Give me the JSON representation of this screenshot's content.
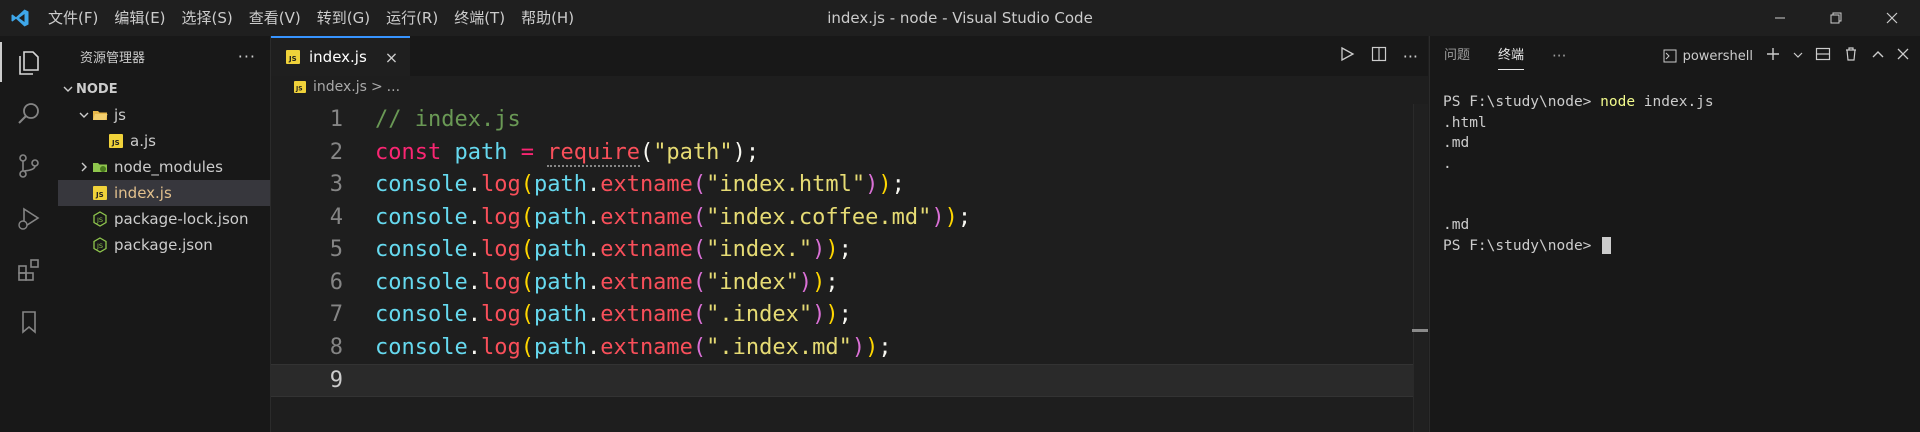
{
  "window": {
    "title": "index.js - node - Visual Studio Code",
    "menu": [
      "文件(F)",
      "编辑(E)",
      "选择(S)",
      "查看(V)",
      "转到(G)",
      "运行(R)",
      "终端(T)",
      "帮助(H)"
    ]
  },
  "sidebar": {
    "title": "资源管理器",
    "more": "···",
    "section": "NODE",
    "items": [
      {
        "label": "js",
        "kind": "folder-open",
        "depth": 1
      },
      {
        "label": "a.js",
        "kind": "js-file",
        "depth": 2
      },
      {
        "label": "node_modules",
        "kind": "folder-collapsed",
        "depth": 1
      },
      {
        "label": "index.js",
        "kind": "js-file",
        "depth": 1,
        "selected": true
      },
      {
        "label": "package-lock.json",
        "kind": "json-file",
        "depth": 1
      },
      {
        "label": "package.json",
        "kind": "json-file",
        "depth": 1
      }
    ]
  },
  "editor": {
    "tab": {
      "label": "index.js",
      "close": "×"
    },
    "breadcrumb": {
      "file": "index.js",
      "sep": ">",
      "more": "..."
    },
    "lines": [
      {
        "num": "1",
        "tokens": [
          {
            "c": "t-comment",
            "t": "// index.js"
          }
        ]
      },
      {
        "num": "2",
        "tokens": [
          {
            "c": "t-kw",
            "t": "const"
          },
          {
            "c": "t-plain",
            "t": " "
          },
          {
            "c": "t-var",
            "t": "path"
          },
          {
            "c": "t-plain",
            "t": " "
          },
          {
            "c": "t-op",
            "t": "="
          },
          {
            "c": "t-plain",
            "t": " "
          },
          {
            "c": "t-fn squiggle",
            "t": "require"
          },
          {
            "c": "t-punc",
            "t": "("
          },
          {
            "c": "t-str",
            "t": "\"path\""
          },
          {
            "c": "t-punc",
            "t": ");"
          }
        ]
      },
      {
        "num": "3",
        "tokens": [
          {
            "c": "t-obj",
            "t": "console"
          },
          {
            "c": "t-punc",
            "t": "."
          },
          {
            "c": "t-fn",
            "t": "log"
          },
          {
            "c": "t-paren1",
            "t": "("
          },
          {
            "c": "t-obj",
            "t": "path"
          },
          {
            "c": "t-punc",
            "t": "."
          },
          {
            "c": "t-fn",
            "t": "extname"
          },
          {
            "c": "t-paren2",
            "t": "("
          },
          {
            "c": "t-str",
            "t": "\"index.html\""
          },
          {
            "c": "t-paren2",
            "t": ")"
          },
          {
            "c": "t-paren1",
            "t": ")"
          },
          {
            "c": "t-punc",
            "t": ";"
          }
        ]
      },
      {
        "num": "4",
        "tokens": [
          {
            "c": "t-obj",
            "t": "console"
          },
          {
            "c": "t-punc",
            "t": "."
          },
          {
            "c": "t-fn",
            "t": "log"
          },
          {
            "c": "t-paren1",
            "t": "("
          },
          {
            "c": "t-obj",
            "t": "path"
          },
          {
            "c": "t-punc",
            "t": "."
          },
          {
            "c": "t-fn",
            "t": "extname"
          },
          {
            "c": "t-paren2",
            "t": "("
          },
          {
            "c": "t-str",
            "t": "\"index.coffee.md\""
          },
          {
            "c": "t-paren2",
            "t": ")"
          },
          {
            "c": "t-paren1",
            "t": ")"
          },
          {
            "c": "t-punc",
            "t": ";"
          }
        ]
      },
      {
        "num": "5",
        "tokens": [
          {
            "c": "t-obj",
            "t": "console"
          },
          {
            "c": "t-punc",
            "t": "."
          },
          {
            "c": "t-fn",
            "t": "log"
          },
          {
            "c": "t-paren1",
            "t": "("
          },
          {
            "c": "t-obj",
            "t": "path"
          },
          {
            "c": "t-punc",
            "t": "."
          },
          {
            "c": "t-fn",
            "t": "extname"
          },
          {
            "c": "t-paren2",
            "t": "("
          },
          {
            "c": "t-str",
            "t": "\"index.\""
          },
          {
            "c": "t-paren2",
            "t": ")"
          },
          {
            "c": "t-paren1",
            "t": ")"
          },
          {
            "c": "t-punc",
            "t": ";"
          }
        ]
      },
      {
        "num": "6",
        "tokens": [
          {
            "c": "t-obj",
            "t": "console"
          },
          {
            "c": "t-punc",
            "t": "."
          },
          {
            "c": "t-fn",
            "t": "log"
          },
          {
            "c": "t-paren1",
            "t": "("
          },
          {
            "c": "t-obj",
            "t": "path"
          },
          {
            "c": "t-punc",
            "t": "."
          },
          {
            "c": "t-fn",
            "t": "extname"
          },
          {
            "c": "t-paren2",
            "t": "("
          },
          {
            "c": "t-str",
            "t": "\"index\""
          },
          {
            "c": "t-paren2",
            "t": ")"
          },
          {
            "c": "t-paren1",
            "t": ")"
          },
          {
            "c": "t-punc",
            "t": ";"
          }
        ]
      },
      {
        "num": "7",
        "tokens": [
          {
            "c": "t-obj",
            "t": "console"
          },
          {
            "c": "t-punc",
            "t": "."
          },
          {
            "c": "t-fn",
            "t": "log"
          },
          {
            "c": "t-paren1",
            "t": "("
          },
          {
            "c": "t-obj",
            "t": "path"
          },
          {
            "c": "t-punc",
            "t": "."
          },
          {
            "c": "t-fn",
            "t": "extname"
          },
          {
            "c": "t-paren2",
            "t": "("
          },
          {
            "c": "t-str",
            "t": "\".index\""
          },
          {
            "c": "t-paren2",
            "t": ")"
          },
          {
            "c": "t-paren1",
            "t": ")"
          },
          {
            "c": "t-punc",
            "t": ";"
          }
        ]
      },
      {
        "num": "8",
        "tokens": [
          {
            "c": "t-obj",
            "t": "console"
          },
          {
            "c": "t-punc",
            "t": "."
          },
          {
            "c": "t-fn",
            "t": "log"
          },
          {
            "c": "t-paren1",
            "t": "("
          },
          {
            "c": "t-obj",
            "t": "path"
          },
          {
            "c": "t-punc",
            "t": "."
          },
          {
            "c": "t-fn",
            "t": "extname"
          },
          {
            "c": "t-paren2",
            "t": "("
          },
          {
            "c": "t-str",
            "t": "\".index.md\""
          },
          {
            "c": "t-paren2",
            "t": ")"
          },
          {
            "c": "t-paren1",
            "t": ")"
          },
          {
            "c": "t-punc",
            "t": ";"
          }
        ]
      },
      {
        "num": "9",
        "tokens": [],
        "current": true
      }
    ]
  },
  "panel": {
    "tabs": [
      "问题",
      "终端"
    ],
    "active_tab": 1,
    "more": "···",
    "terminal_name": "powershell",
    "terminal": [
      {
        "prompt": "PS F:\\study\\node> ",
        "cmd": "node",
        "rest": " index.js"
      },
      {
        "text": ".html"
      },
      {
        "text": ".md"
      },
      {
        "text": "."
      },
      {
        "text": ""
      },
      {
        "text": ""
      },
      {
        "text": ".md"
      },
      {
        "prompt": "PS F:\\study\\node> ",
        "cursor": true
      }
    ]
  },
  "colors": {
    "accent": "#3794ff",
    "vscode_logo": "#3ea7ea",
    "js_icon": "#f0d23a",
    "json_icon": "#8fc64d",
    "selected_file": "#e2c08d"
  }
}
